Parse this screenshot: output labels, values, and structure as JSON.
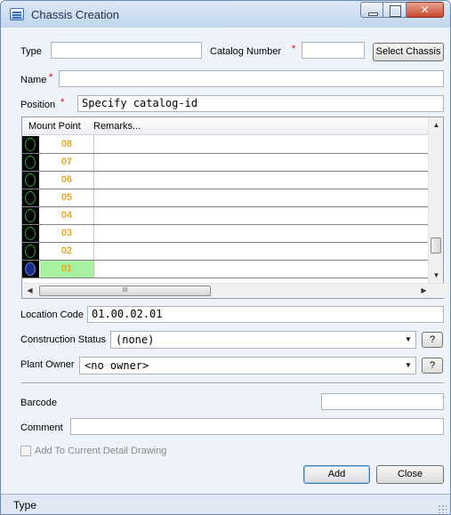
{
  "window": {
    "title": "Chassis Creation",
    "icon": "app-icon"
  },
  "form": {
    "type_label": "Type",
    "type_value": "",
    "catalog_number_label": "Catalog Number",
    "catalog_number_value": "",
    "select_chassis_label": "Select Chassis",
    "name_label": "Name",
    "name_value": "",
    "position_label": "Position",
    "position_value": "Specify catalog-id",
    "required_marker": "*"
  },
  "grid": {
    "columns": [
      "Mount Point",
      "Remarks..."
    ],
    "rows": [
      {
        "mount_point": "08",
        "remarks": "",
        "selected": false
      },
      {
        "mount_point": "07",
        "remarks": "",
        "selected": false
      },
      {
        "mount_point": "06",
        "remarks": "",
        "selected": false
      },
      {
        "mount_point": "05",
        "remarks": "",
        "selected": false
      },
      {
        "mount_point": "04",
        "remarks": "",
        "selected": false
      },
      {
        "mount_point": "03",
        "remarks": "",
        "selected": false
      },
      {
        "mount_point": "02",
        "remarks": "",
        "selected": false
      },
      {
        "mount_point": "01",
        "remarks": "",
        "selected": true
      }
    ],
    "hscroll_thumb_glyph": "III"
  },
  "location": {
    "label": "Location Code",
    "value": "01.00.02.01"
  },
  "construction": {
    "label": "Construction Status",
    "value": "(none)",
    "help_label": "?"
  },
  "plant_owner": {
    "label": "Plant Owner",
    "value": "<no owner>",
    "help_label": "?"
  },
  "barcode": {
    "label": "Barcode",
    "value": ""
  },
  "comment": {
    "label": "Comment",
    "value": ""
  },
  "add_to_drawing": {
    "label": "Add To Current Detail Drawing",
    "checked": false,
    "enabled": false
  },
  "buttons": {
    "add_label": "Add",
    "close_label": "Close"
  },
  "status_bar": {
    "text": "Type"
  },
  "colors": {
    "mount_point_text": "#e8a820",
    "selected_row": "#a7f0a0",
    "required": "#d40000",
    "disabled_text": "#8a8a8a"
  }
}
